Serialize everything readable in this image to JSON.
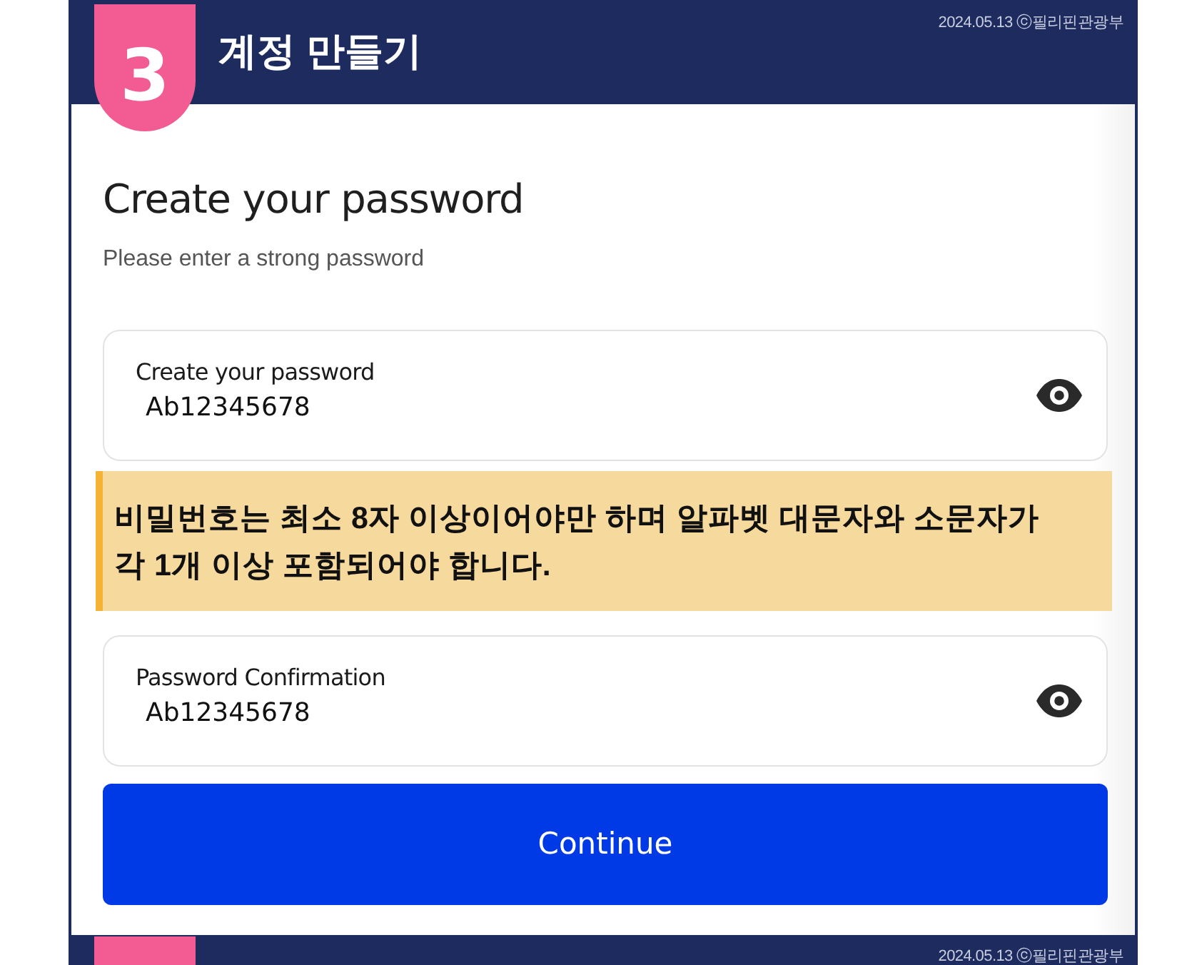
{
  "header": {
    "step": "3",
    "title": "계정 만들기",
    "credit": "2024.05.13 ⓒ필리핀관광부"
  },
  "form": {
    "title": "Create your password",
    "subtitle": "Please enter a strong password",
    "items": [
      {
        "kind": "field",
        "label": "Create your password",
        "value": "Ab12345678"
      },
      {
        "kind": "notice",
        "text": "비밀번호는 최소 8자 이상이어야만 하며 알파벳 대문자와 소문자가 각 1개 이상 포함되어야 합니다."
      },
      {
        "kind": "field",
        "label": "Password Confirmation",
        "value": "Ab12345678"
      }
    ],
    "button": {
      "label": "Continue"
    }
  },
  "footer": {
    "credit": "2024.05.13 ⓒ필리핀관광부"
  }
}
